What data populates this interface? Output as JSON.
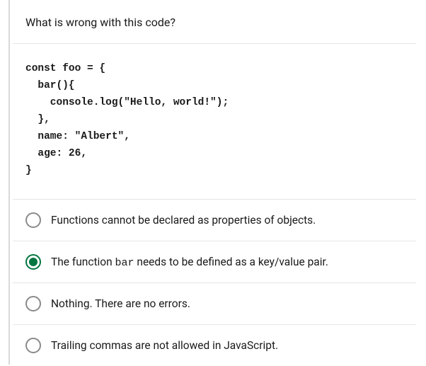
{
  "question": "What is wrong with this code?",
  "code": "const foo = {\n  bar(){\n    console.log(\"Hello, world!\");\n  },\n  name: \"Albert\",\n  age: 26,\n}",
  "options": [
    {
      "pre": "Functions cannot be declared as properties of objects.",
      "code": "",
      "post": "",
      "selected": false
    },
    {
      "pre": "The function ",
      "code": "bar",
      "post": " needs to be defined as a key/value pair.",
      "selected": true
    },
    {
      "pre": "Nothing. There are no errors.",
      "code": "",
      "post": "",
      "selected": false
    },
    {
      "pre": "Trailing commas are not allowed in JavaScript.",
      "code": "",
      "post": "",
      "selected": false
    }
  ]
}
